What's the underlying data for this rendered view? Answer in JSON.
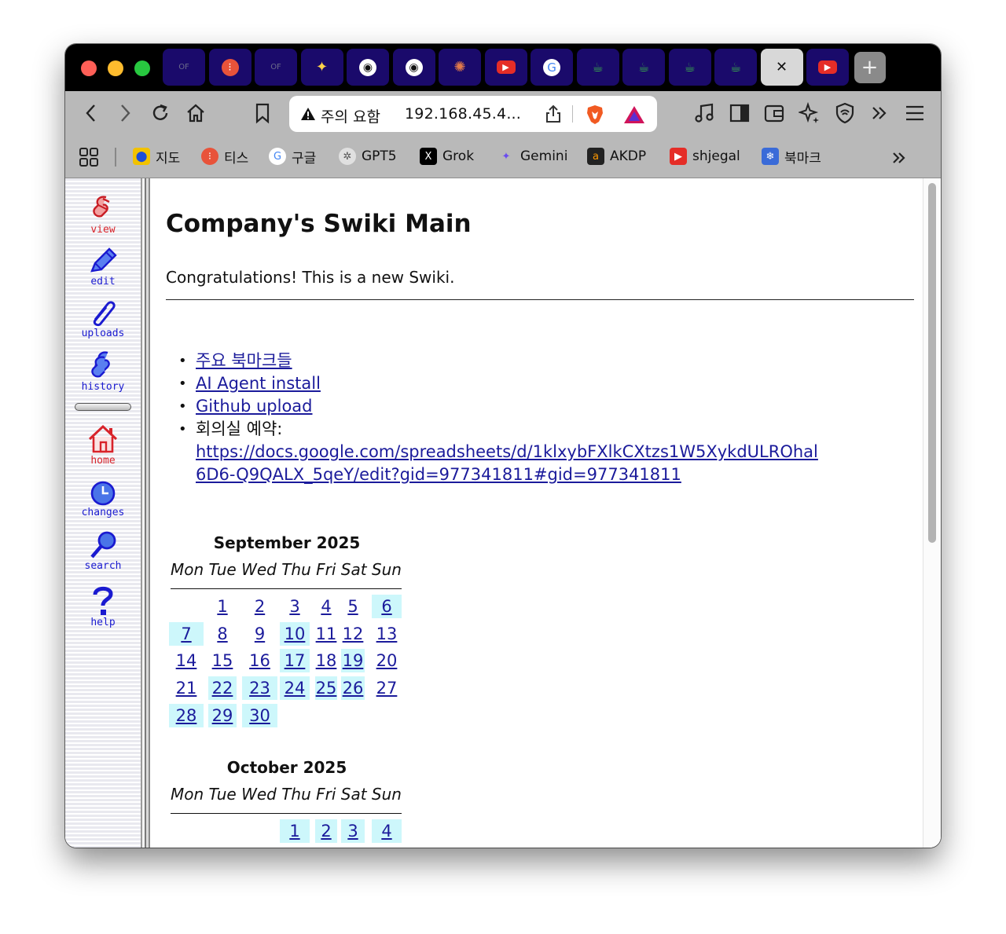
{
  "browser": {
    "tabs": [
      {
        "name": "tab-1",
        "icon": "of-logo-icon",
        "active": false
      },
      {
        "name": "tab-2",
        "icon": "tis-icon",
        "active": false
      },
      {
        "name": "tab-3",
        "icon": "of-logo-icon",
        "active": false
      },
      {
        "name": "tab-4",
        "icon": "gemini-icon",
        "active": false
      },
      {
        "name": "tab-5",
        "icon": "app-icon",
        "active": false
      },
      {
        "name": "tab-6",
        "icon": "app-icon",
        "active": false
      },
      {
        "name": "tab-7",
        "icon": "claude-icon",
        "active": false
      },
      {
        "name": "tab-8",
        "icon": "youtube-icon",
        "active": false
      },
      {
        "name": "tab-9",
        "icon": "google-icon",
        "active": false
      },
      {
        "name": "tab-10",
        "icon": "cup-icon",
        "active": false
      },
      {
        "name": "tab-11",
        "icon": "cup-icon",
        "active": false
      },
      {
        "name": "tab-12",
        "icon": "cup-icon",
        "active": false
      },
      {
        "name": "tab-13",
        "icon": "cup-icon",
        "active": false
      },
      {
        "name": "tab-14",
        "icon": "close-icon",
        "active": true
      },
      {
        "name": "tab-15",
        "icon": "youtube-icon",
        "active": false
      }
    ],
    "address": {
      "warning_label": "주의 요함",
      "url": "192.168.45.4..."
    },
    "bookmarks": [
      {
        "label": "지도",
        "icon": "map-pin-icon",
        "color": "#f2c200"
      },
      {
        "label": "티스",
        "icon": "tis-icon",
        "color": "#e8533a"
      },
      {
        "label": "구글",
        "icon": "google-icon",
        "color": "#ffffff"
      },
      {
        "label": "GPT5",
        "icon": "openai-icon",
        "color": "#e0e0e0"
      },
      {
        "label": "Grok",
        "icon": "x-icon",
        "color": "#000000"
      },
      {
        "label": "Gemini",
        "icon": "gemini-icon",
        "color": "#b9b9b9"
      },
      {
        "label": "AKDP",
        "icon": "amazon-icon",
        "color": "#222222"
      },
      {
        "label": "shjegal",
        "icon": "youtube-icon",
        "color": "#e52d27"
      },
      {
        "label": "북마크",
        "icon": "snowflake-icon",
        "color": "#3a6bd8"
      }
    ]
  },
  "sidebar": {
    "items": [
      {
        "label": "view",
        "color": "#d8232a"
      },
      {
        "label": "edit",
        "color": "#1a1ad0"
      },
      {
        "label": "uploads",
        "color": "#1a1ad0"
      },
      {
        "label": "history",
        "color": "#1a1ad0"
      },
      {
        "label": "home",
        "color": "#d8232a"
      },
      {
        "label": "changes",
        "color": "#1a1ad0"
      },
      {
        "label": "search",
        "color": "#1a1ad0"
      },
      {
        "label": "help",
        "color": "#1a1ad0"
      }
    ]
  },
  "page": {
    "title": "Company's Swiki Main",
    "intro": "Congratulations! This is a new Swiki.",
    "links": [
      {
        "text": "주요 북마크들"
      },
      {
        "text": "AI Agent install"
      },
      {
        "text": "Github upload"
      },
      {
        "prefix": "회의실 예약:",
        "text": "https://docs.google.com/spreadsheets/d/1klxybFXlkCXtzs1W5XykdULROhal6D6-Q9QALX_5qeY/edit?gid=977341811#gid=977341811"
      }
    ]
  },
  "calendars": [
    {
      "title": "September 2025",
      "weekdays": "Mon Tue Wed Thu Fri Sat Sun",
      "days": [
        {
          "d": "1",
          "row": 0,
          "col": 1,
          "hl": false
        },
        {
          "d": "2",
          "row": 0,
          "col": 2,
          "hl": false
        },
        {
          "d": "3",
          "row": 0,
          "col": 3,
          "hl": false
        },
        {
          "d": "4",
          "row": 0,
          "col": 4,
          "hl": false
        },
        {
          "d": "5",
          "row": 0,
          "col": 5,
          "hl": false
        },
        {
          "d": "6",
          "row": 0,
          "col": 6,
          "hl": true
        },
        {
          "d": "7",
          "row": 1,
          "col": 0,
          "hl": true
        },
        {
          "d": "8",
          "row": 1,
          "col": 1,
          "hl": false
        },
        {
          "d": "9",
          "row": 1,
          "col": 2,
          "hl": false
        },
        {
          "d": "10",
          "row": 1,
          "col": 3,
          "hl": true
        },
        {
          "d": "11",
          "row": 1,
          "col": 4,
          "hl": false
        },
        {
          "d": "12",
          "row": 1,
          "col": 5,
          "hl": false
        },
        {
          "d": "13",
          "row": 1,
          "col": 6,
          "hl": false
        },
        {
          "d": "14",
          "row": 2,
          "col": 0,
          "hl": false
        },
        {
          "d": "15",
          "row": 2,
          "col": 1,
          "hl": false
        },
        {
          "d": "16",
          "row": 2,
          "col": 2,
          "hl": false
        },
        {
          "d": "17",
          "row": 2,
          "col": 3,
          "hl": true
        },
        {
          "d": "18",
          "row": 2,
          "col": 4,
          "hl": false
        },
        {
          "d": "19",
          "row": 2,
          "col": 5,
          "hl": true
        },
        {
          "d": "20",
          "row": 2,
          "col": 6,
          "hl": false
        },
        {
          "d": "21",
          "row": 3,
          "col": 0,
          "hl": false
        },
        {
          "d": "22",
          "row": 3,
          "col": 1,
          "hl": true
        },
        {
          "d": "23",
          "row": 3,
          "col": 2,
          "hl": true
        },
        {
          "d": "24",
          "row": 3,
          "col": 3,
          "hl": true
        },
        {
          "d": "25",
          "row": 3,
          "col": 4,
          "hl": true
        },
        {
          "d": "26",
          "row": 3,
          "col": 5,
          "hl": true
        },
        {
          "d": "27",
          "row": 3,
          "col": 6,
          "hl": false
        },
        {
          "d": "28",
          "row": 4,
          "col": 0,
          "hl": true
        },
        {
          "d": "29",
          "row": 4,
          "col": 1,
          "hl": true
        },
        {
          "d": "30",
          "row": 4,
          "col": 2,
          "hl": true
        }
      ]
    },
    {
      "title": "October 2025",
      "weekdays": "Mon Tue Wed Thu Fri Sat Sun",
      "days": [
        {
          "d": "1",
          "row": 0,
          "col": 3,
          "hl": true
        },
        {
          "d": "2",
          "row": 0,
          "col": 4,
          "hl": true
        },
        {
          "d": "3",
          "row": 0,
          "col": 5,
          "hl": true
        },
        {
          "d": "4",
          "row": 0,
          "col": 6,
          "hl": true
        }
      ]
    }
  ]
}
